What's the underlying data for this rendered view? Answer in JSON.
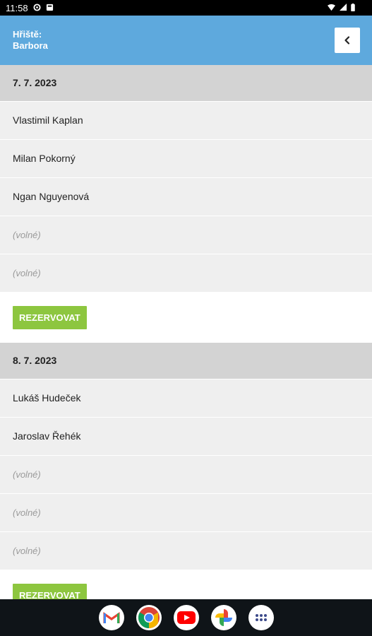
{
  "status_bar": {
    "time": "11:58"
  },
  "header": {
    "title_line1": "Hřiště:",
    "title_line2": "Barbora"
  },
  "days": [
    {
      "date": "7. 7. 2023",
      "entries": [
        "Vlastimil Kaplan",
        "Milan Pokorný",
        "Ngan Nguyenová",
        "(volné)",
        "(volné)"
      ],
      "button_label": "REZERVOVAT"
    },
    {
      "date": "8. 7. 2023",
      "entries": [
        "Lukáš Hudeček",
        "Jaroslav Řehék",
        "(volné)",
        "(volné)",
        "(volné)"
      ],
      "button_label": "REZERVOVAT"
    }
  ],
  "nav_apps": [
    "gmail-icon",
    "chrome-icon",
    "youtube-icon",
    "photos-icon",
    "app-drawer-icon"
  ],
  "colors": {
    "header": "#5ea9dd",
    "button": "#8dc63f",
    "date_bg": "#d3d3d3",
    "row_bg": "#efefef"
  }
}
